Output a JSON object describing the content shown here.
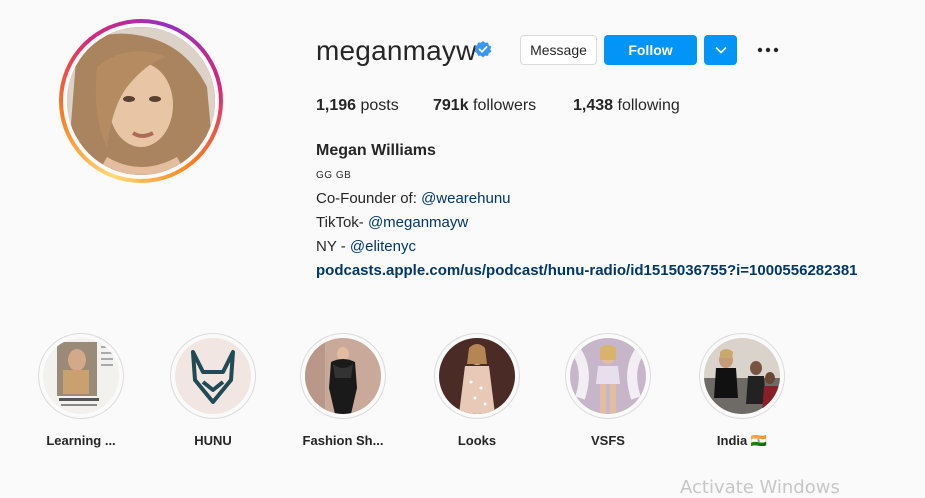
{
  "profile": {
    "username": "meganmayw",
    "verified": true,
    "buttons": {
      "message": "Message",
      "follow": "Follow"
    },
    "stats": {
      "posts_count": "1,196",
      "posts_label": " posts",
      "followers_count": "791k",
      "followers_label": " followers",
      "following_count": "1,438",
      "following_label": " following"
    },
    "full_name": "Megan Williams",
    "bio": {
      "flags": "GG GB",
      "line1_prefix": "Co-Founder of: ",
      "line1_mention": "@wearehunu",
      "line2_prefix": "TikTok- ",
      "line2_mention": "@meganmayw",
      "line3_prefix": "NY - ",
      "line3_mention": "@elitenyc",
      "link": "podcasts.apple.com/us/podcast/hunu-radio/id1515036755?i=1000556282381"
    }
  },
  "highlights": [
    {
      "label": "Learning ..."
    },
    {
      "label": "HUNU"
    },
    {
      "label": "Fashion Sh..."
    },
    {
      "label": "Looks"
    },
    {
      "label": "VSFS"
    },
    {
      "label": "India 🇮🇳"
    }
  ],
  "watermark": "Activate Windows",
  "colors": {
    "accent": "#0095f6",
    "link": "#00376b",
    "verified": "#3897f0"
  }
}
